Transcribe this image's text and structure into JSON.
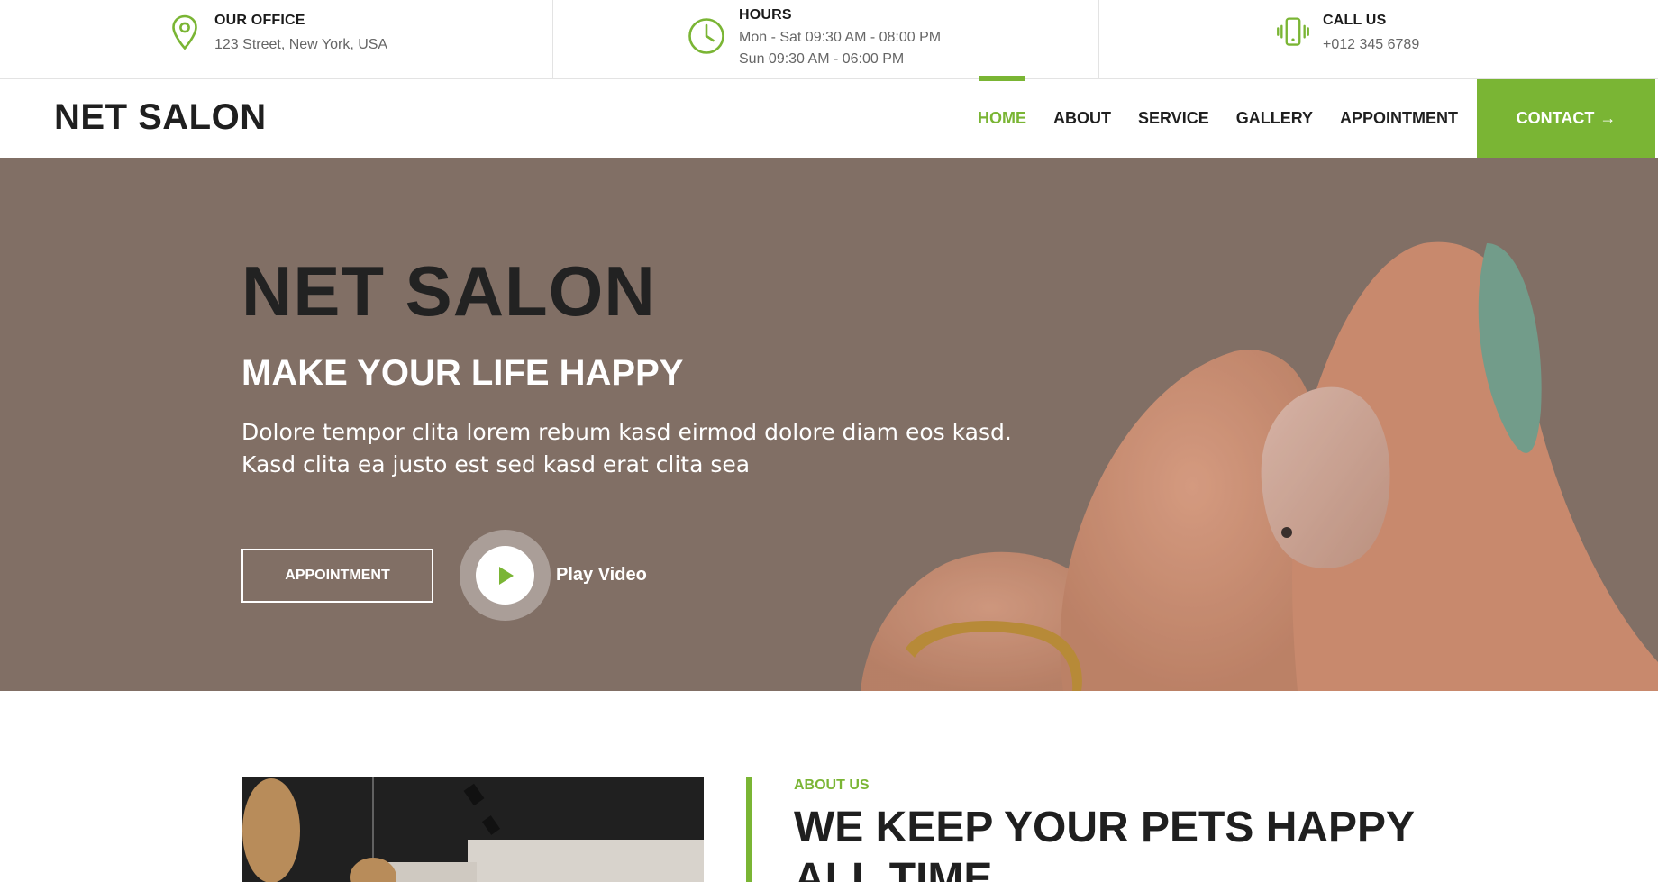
{
  "topbar": {
    "office": {
      "title": "OUR OFFICE",
      "line1": "123 Street, New York, USA"
    },
    "hours": {
      "title": "HOURS",
      "line1": "Mon - Sat 09:30 AM - 08:00 PM",
      "line2": "Sun 09:30 AM - 06:00 PM"
    },
    "call": {
      "title": "CALL US",
      "line1": "+012 345 6789"
    }
  },
  "nav": {
    "brand": "NET SALON",
    "links": [
      "HOME",
      "ABOUT",
      "SERVICE",
      "GALLERY",
      "APPOINTMENT"
    ],
    "active": "HOME",
    "contact": "CONTACT",
    "contact_arrow": "→"
  },
  "hero": {
    "title": "NET SALON",
    "subtitle": "MAKE YOUR LIFE HAPPY",
    "text_line1": "Dolore tempor clita lorem rebum kasd eirmod dolore diam eos kasd.",
    "text_line2": "Kasd clita ea justo est sed kasd erat clita sea",
    "button": "APPOINTMENT",
    "play_label": "Play Video"
  },
  "about": {
    "subtitle": "ABOUT US",
    "title_line1": "WE KEEP YOUR PETS HAPPY",
    "title_line2": "ALL TIME"
  },
  "colors": {
    "accent": "#7ab534",
    "hero_bg": "#827066",
    "text_dark": "#1f1f1f"
  },
  "icons": [
    "map-pin-icon",
    "clock-icon",
    "phone-vibrate-icon",
    "arrow-right-icon",
    "play-icon"
  ]
}
